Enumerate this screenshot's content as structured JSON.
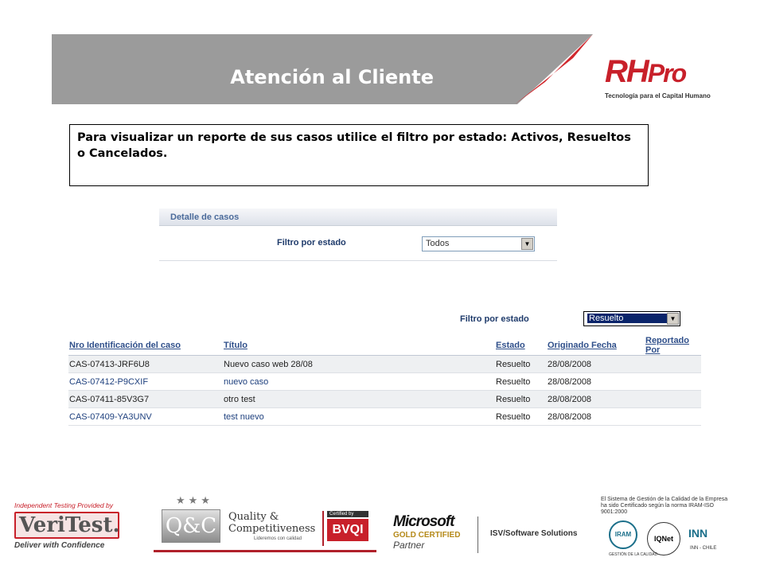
{
  "header": {
    "title": "Atención al Cliente",
    "banner_color": "#9b9b9b",
    "accent_color": "#d0282d"
  },
  "logo": {
    "main": "RH",
    "pro": "Pro",
    "tagline": "Tecnología para el Capital Humano"
  },
  "info": {
    "text": "Para visualizar un reporte de  sus casos utilice el filtro por estado: Activos, Resueltos o Cancelados."
  },
  "detail": {
    "title": "Detalle de casos",
    "filter_label": "Filtro por estado",
    "filter_value": "Todos"
  },
  "cases": {
    "filter_label": "Filtro por estado",
    "filter_value": "Resuelto",
    "columns": [
      "Nro Identificación del caso",
      "Título",
      "Estado",
      "Originado Fecha",
      "Reportado Por"
    ],
    "rows": [
      {
        "id": "CAS-07413-JRF6U8",
        "title": "Nuevo caso web 28/08",
        "status": "Resuelto",
        "date": "28/08/2008",
        "reporter": ""
      },
      {
        "id": "CAS-07412-P9CXIF",
        "title": "nuevo caso",
        "status": "Resuelto",
        "date": "28/08/2008",
        "reporter": ""
      },
      {
        "id": "CAS-07411-85V3G7",
        "title": "otro test",
        "status": "Resuelto",
        "date": "28/08/2008",
        "reporter": ""
      },
      {
        "id": "CAS-07409-YA3UNV",
        "title": "test nuevo",
        "status": "Resuelto",
        "date": "28/08/2008",
        "reporter": ""
      }
    ]
  },
  "footer": {
    "veritest": {
      "top": "Independent Testing Provided by",
      "name": "VeriTest.",
      "bottom": "Deliver with Confidence"
    },
    "qc": {
      "stars": "★★★",
      "badge": "Q&C",
      "title_line1": "Quality &",
      "title_line2": "Competitiveness",
      "subtitle": "Lideremos con calidad",
      "certified": "Certified by",
      "bvqi": "BVQI"
    },
    "microsoft": {
      "name": "Microsoft",
      "gold": "GOLD CERTIFIED",
      "partner": "Partner",
      "isv": "ISV/Software Solutions"
    },
    "iram": {
      "text": "El Sistema de Gestión de la Calidad de la Empresa ha sido Certificado según la norma IRAM-ISO 9001:2000",
      "iram": "IRAM",
      "iram_caption": "GESTIÓN DE LA CALIDAD",
      "iqnet": "IQNet",
      "inn": "INN",
      "inn_caption": "INN - CHILE"
    }
  }
}
